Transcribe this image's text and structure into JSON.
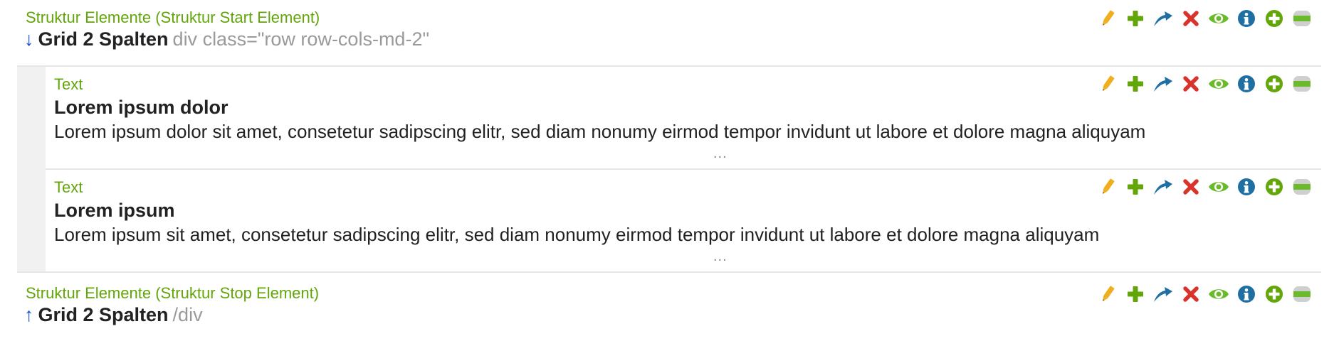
{
  "blocks": {
    "start": {
      "type_label": "Struktur Elemente (Struktur Start Element)",
      "arrow": "↓",
      "name": "Grid 2 Spalten",
      "code": "div class=\"row row-cols-md-2\""
    },
    "children": [
      {
        "type_label": "Text",
        "headline": "Lorem ipsum dolor",
        "text": "Lorem ipsum dolor sit amet, consetetur sadipscing elitr, sed diam nonumy eirmod tempor invidunt ut labore et dolore magna aliquyam",
        "more": "..."
      },
      {
        "type_label": "Text",
        "headline": "Lorem ipsum",
        "text": "Lorem ipsum sit amet, consetetur sadipscing elitr, sed diam nonumy eirmod tempor invidunt ut labore et dolore magna aliquyam",
        "more": "..."
      }
    ],
    "stop": {
      "type_label": "Struktur Elemente (Struktur Stop Element)",
      "arrow": "↑",
      "name": "Grid 2 Spalten",
      "code": "/div"
    }
  },
  "actions": [
    "edit-icon",
    "add-icon",
    "move-icon",
    "delete-icon",
    "visibility-icon",
    "info-icon",
    "add-after-icon",
    "toggle-icon"
  ],
  "colors": {
    "type_label": "#62a60a",
    "edit": "#f0ad1e",
    "add": "#62a60a",
    "move": "#1f6fa3",
    "delete": "#d9342b",
    "visibility": "#6aba2c",
    "info": "#1f6fa3",
    "toggle": "#6aba2c",
    "arrow": "#1a4fd6"
  }
}
